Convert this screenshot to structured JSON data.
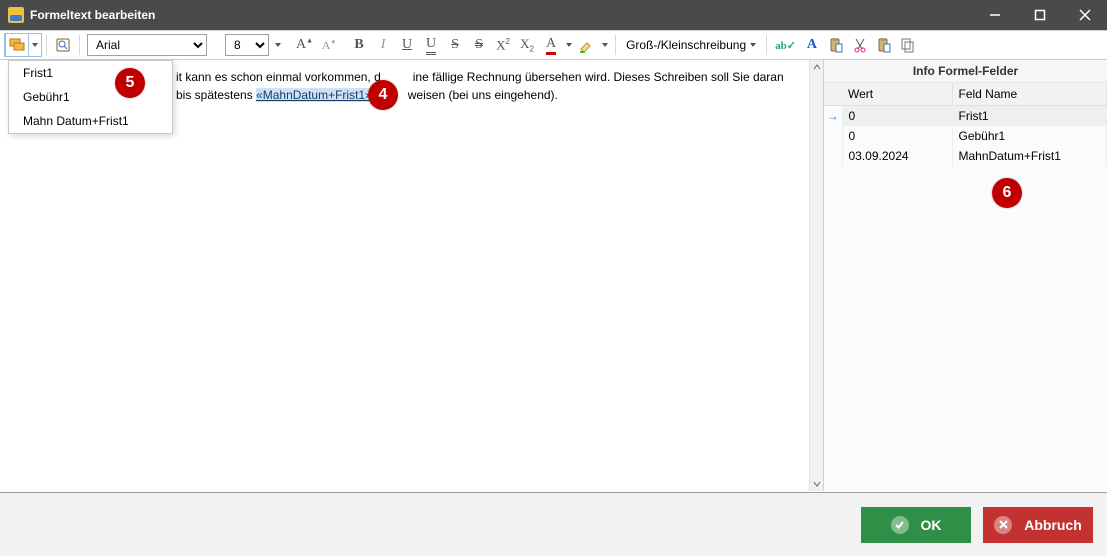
{
  "window": {
    "title": "Formeltext bearbeiten"
  },
  "toolbar": {
    "font_name": "Arial",
    "font_size": "8",
    "case_label": "Groß-/Kleinschreibung"
  },
  "dropdown": {
    "items": [
      {
        "label": "Frist1"
      },
      {
        "label": "Gebühr1"
      },
      {
        "label": "Mahn Datum+Frist1"
      }
    ]
  },
  "editor": {
    "line1_partial": "it kann es schon einmal vorkommen, d",
    "line1_rest": "ine fällige Rechnung übersehen wird. Dieses Schreiben soll Sie daran",
    "line2_prefix": "bis spätestens ",
    "merge_field": "«MahnDatum+Frist1»",
    "line2_rest": "weisen (bei uns eingehend)."
  },
  "sidepanel": {
    "title": "Info Formel-Felder",
    "columns": {
      "wert": "Wert",
      "feld": "Feld Name"
    },
    "rows": [
      {
        "arrow": true,
        "wert": "0",
        "feld": "Frist1",
        "selected": true
      },
      {
        "arrow": false,
        "wert": "0",
        "feld": "Gebühr1",
        "selected": false
      },
      {
        "arrow": false,
        "wert": "03.09.2024",
        "feld": "MahnDatum+Frist1",
        "selected": false
      }
    ]
  },
  "footer": {
    "ok": "OK",
    "cancel": "Abbruch"
  },
  "annotations": {
    "b4": "4",
    "b5": "5",
    "b6": "6"
  }
}
